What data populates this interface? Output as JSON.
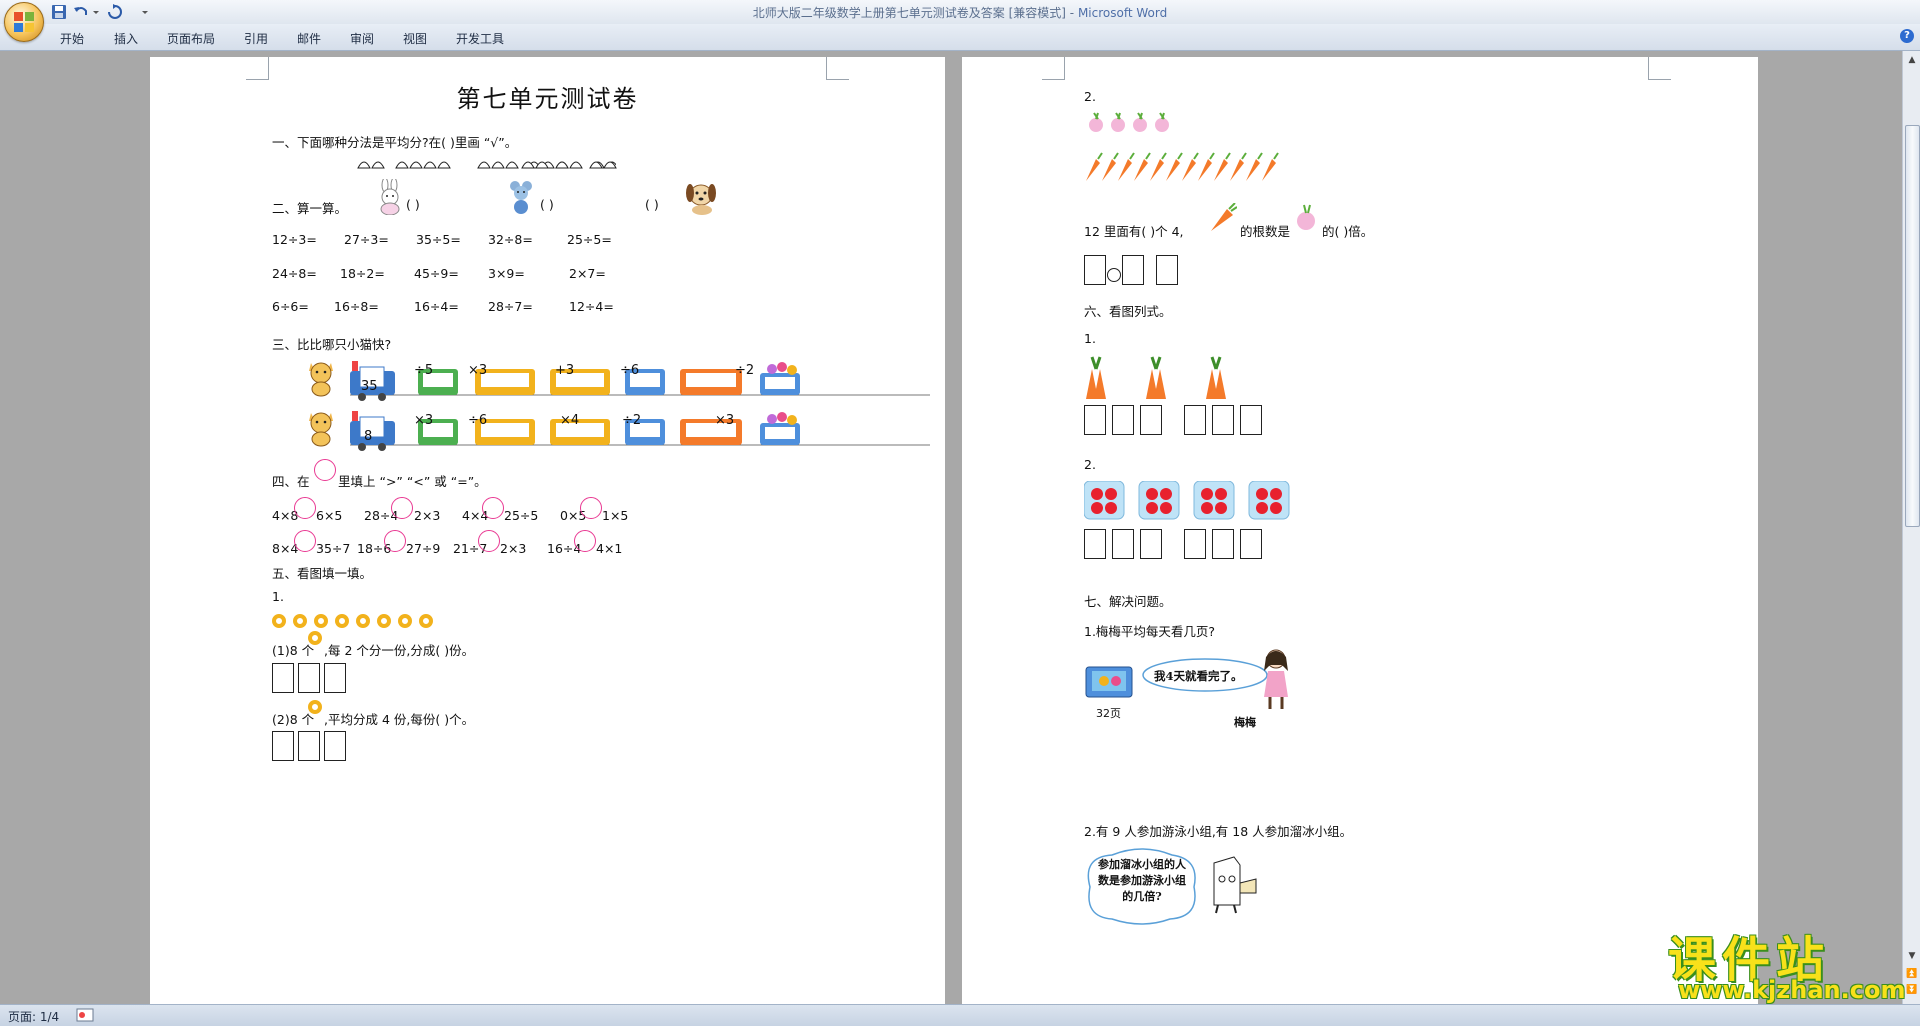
{
  "window": {
    "title": "北师大版二年级数学上册第七单元测试卷及答案 [兼容模式]",
    "app_separator": " - ",
    "app_name": "Microsoft Word"
  },
  "ribbon": {
    "tabs": [
      "开始",
      "插入",
      "页面布局",
      "引用",
      "邮件",
      "审阅",
      "视图",
      "开发工具"
    ]
  },
  "status": {
    "page": "页面: 1/4"
  },
  "colors": {
    "accent": "#e93a93",
    "ring": "#f2b21c",
    "carrot": "#f47a2a",
    "strawberry": "#e8212e"
  },
  "page1": {
    "title": "第七单元测试卷",
    "s1": {
      "heading": "一、下面哪种分法是平均分?在(      )里画 “√”。",
      "blanks": [
        "(      )",
        "(      )",
        "(      )"
      ]
    },
    "s2": {
      "heading": "二、算一算。",
      "rows": [
        [
          "12÷3=",
          "27÷3=",
          "35÷5=",
          "32÷8=",
          "25÷5="
        ],
        [
          "24÷8=",
          "18÷2=",
          "45÷9=",
          "3×9=",
          "2×7="
        ],
        [
          "6÷6=",
          "16÷8=",
          "16÷4=",
          "28÷7=",
          "12÷4="
        ]
      ]
    },
    "s3": {
      "heading": "三、比比哪只小猫快?",
      "train1": {
        "start": "35",
        "ops": [
          "÷5",
          "×3",
          "+3",
          "÷6",
          "÷2"
        ]
      },
      "train2": {
        "start": "8",
        "ops": [
          "×3",
          "÷6",
          "×4",
          "÷2",
          "×3"
        ]
      }
    },
    "s4": {
      "heading_a": "四、在",
      "heading_b": "里填上 “>” “<” 或 “=”。",
      "row1": [
        [
          "4×8",
          "6×5"
        ],
        [
          "28÷4",
          "2×3"
        ],
        [
          "4×4",
          "25÷5"
        ],
        [
          "0×5",
          "1×5"
        ]
      ],
      "row2": [
        [
          "8×4",
          "35÷7"
        ],
        [
          "18÷6",
          "27÷9"
        ],
        [
          "21÷7",
          "2×3"
        ],
        [
          "16÷4",
          "4×1"
        ]
      ]
    },
    "s5": {
      "heading": "五、看图填一填。",
      "q1": "1.",
      "p1a": "(1)8 个",
      "p1b": ",每 2 个分一份,分成(      )份。",
      "p2a": "(2)8 个",
      "p2b": ",平均分成 4 份,每份(      )个。"
    }
  },
  "page2": {
    "q2": "2.",
    "line_a": "12 里面有(      )个 4,",
    "line_b": "的根数是",
    "line_c": "的(      )倍。",
    "s6": {
      "heading": "六、看图列式。",
      "q1": "1.",
      "q2": "2."
    },
    "s7": {
      "heading": "七、解决问题。",
      "q1": "1.梅梅平均每天看几页?",
      "bubble1": "我4天就看完了。",
      "book": "32页",
      "name": "梅梅",
      "q2": "2.有 9 人参加游泳小组,有 18 人参加溜冰小组。",
      "bubble2": "参加溜冰小组的人数是参加游泳小组的几倍?"
    }
  },
  "watermark": {
    "main": "课件站",
    "url": "www.kjzhan.com"
  }
}
